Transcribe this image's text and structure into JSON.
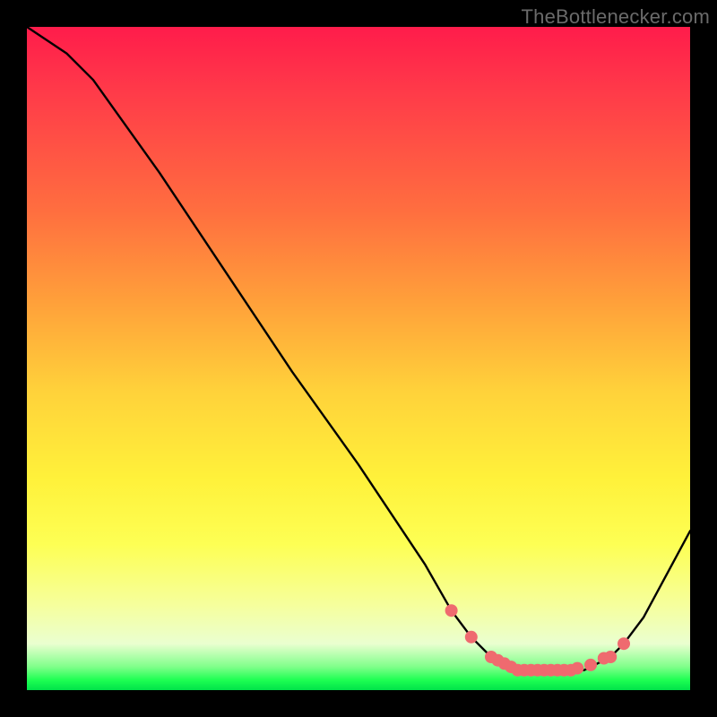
{
  "watermark": "TheBottlenecker.com",
  "chart_data": {
    "type": "line",
    "title": "",
    "xlabel": "",
    "ylabel": "",
    "xlim": [
      0,
      100
    ],
    "ylim": [
      0,
      100
    ],
    "series": [
      {
        "name": "curve",
        "x": [
          0,
          6,
          10,
          20,
          30,
          40,
          50,
          60,
          64,
          67,
          70,
          72,
          74,
          76,
          78,
          80,
          82,
          84,
          86,
          88,
          90,
          93,
          100
        ],
        "y": [
          100,
          96,
          92,
          78,
          63,
          48,
          34,
          19,
          12,
          8,
          5,
          4,
          3,
          3,
          3,
          3,
          3,
          3,
          4,
          5,
          7,
          11,
          24
        ]
      }
    ],
    "markers": {
      "name": "highlight",
      "x": [
        64,
        67,
        70,
        71,
        72,
        73,
        74,
        75,
        76,
        77,
        78,
        79,
        80,
        81,
        82,
        83,
        85,
        87,
        88,
        90
      ],
      "y": [
        12,
        8,
        5,
        4.5,
        4,
        3.5,
        3,
        3,
        3,
        3,
        3,
        3,
        3,
        3,
        3,
        3.3,
        3.8,
        4.8,
        5,
        7
      ],
      "color": "#ef6a6f",
      "radius": 7
    },
    "colors": {
      "line": "#000000",
      "marker": "#ef6a6f"
    }
  }
}
